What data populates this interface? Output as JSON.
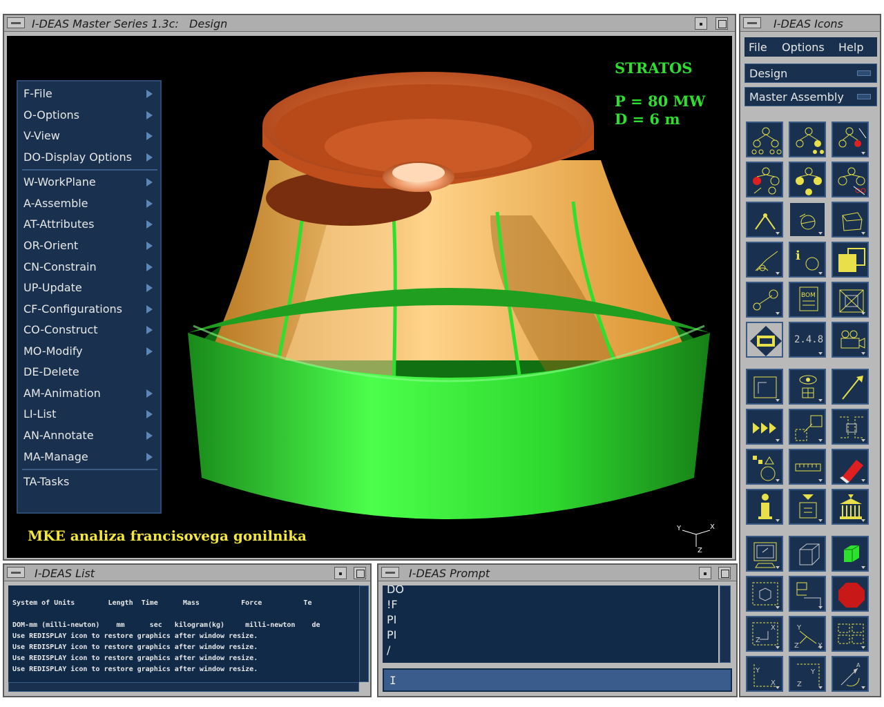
{
  "graphics_window": {
    "title": "I-DEAS Master Series 1.3c:",
    "task": "Design"
  },
  "task_menu": {
    "items": [
      {
        "label": "F-File",
        "submenu": true
      },
      {
        "label": "O-Options",
        "submenu": true
      },
      {
        "label": "V-View",
        "submenu": true
      },
      {
        "label": "DO-Display Options",
        "submenu": true
      },
      {
        "label": "W-WorkPlane",
        "submenu": true
      },
      {
        "label": "A-Assemble",
        "submenu": true
      },
      {
        "label": "AT-Attributes",
        "submenu": true
      },
      {
        "label": "OR-Orient",
        "submenu": true
      },
      {
        "label": "CN-Constrain",
        "submenu": true
      },
      {
        "label": "UP-Update",
        "submenu": true
      },
      {
        "label": "CF-Configurations",
        "submenu": true
      },
      {
        "label": "CO-Construct",
        "submenu": true
      },
      {
        "label": "MO-Modify",
        "submenu": true
      },
      {
        "label": "DE-Delete",
        "submenu": false
      },
      {
        "label": "AM-Animation",
        "submenu": true
      },
      {
        "label": "LI-List",
        "submenu": true
      },
      {
        "label": "AN-Annotate",
        "submenu": true
      },
      {
        "label": "MA-Manage",
        "submenu": true
      },
      {
        "label": "TA-Tasks",
        "submenu": false
      }
    ]
  },
  "annotations": {
    "name": "STRATOS",
    "power": "P = 80 MW",
    "diameter": "D = 6 m",
    "caption": "MKE analiza francisovega gonilnika"
  },
  "triad": {
    "y": "Y",
    "x": "X",
    "z": "Z"
  },
  "icons_window": {
    "title": "I-DEAS Icons",
    "menu": [
      "File",
      "Options",
      "Help"
    ],
    "application": "Design",
    "task": "Master Assembly",
    "numbers_icon_label": "2.4.8"
  },
  "list_window": {
    "title": "I-DEAS List",
    "lines": [
      "System of Units        Length  Time      Mass          Force          Te",
      "",
      "DOM-mm (milli-newton)    mm      sec   kilogram(kg)     milli-newton    de",
      "Use REDISPLAY icon to restore graphics after window resize.",
      "Use REDISPLAY icon to restore graphics after window resize.",
      "Use REDISPLAY icon to restore graphics after window resize.",
      "Use REDISPLAY icon to restore graphics after window resize."
    ]
  },
  "prompt_window": {
    "title": "I-DEAS Prompt",
    "history": [
      "DO",
      "!F",
      "PI",
      "PI",
      "/"
    ],
    "input_value": ""
  },
  "colors": {
    "menu_bg": "#19314e",
    "runner_shroud": "#2ee02e",
    "runner_crown": "#c85a1e",
    "runner_blades": "#f0b04a",
    "annotation_green": "#2ee02e",
    "caption_yellow": "#f5e63a"
  }
}
